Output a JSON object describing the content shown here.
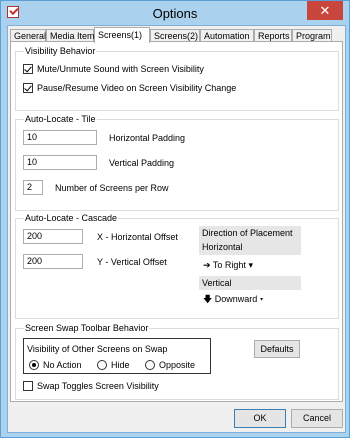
{
  "window": {
    "title": "Options",
    "close_glyph": "✕"
  },
  "tabs": [
    {
      "label": "General"
    },
    {
      "label": "Media Item"
    },
    {
      "label": "Screens(1)"
    },
    {
      "label": "Screens(2)"
    },
    {
      "label": "Automation"
    },
    {
      "label": "Reports"
    },
    {
      "label": "Program"
    }
  ],
  "visibility": {
    "title": "Visibility Behavior",
    "mute_label": "Mute/Unmute Sound with Screen Visibility",
    "mute_checked": true,
    "pause_label": "Pause/Resume Video on Screen Visibility Change",
    "pause_checked": true
  },
  "tile": {
    "title": "Auto-Locate  - Tile",
    "h_padding_value": "10",
    "h_padding_label": "Horizontal Padding",
    "v_padding_value": "10",
    "v_padding_label": "Vertical Padding",
    "screens_per_row_value": "2",
    "screens_per_row_label": "Number of Screens per Row"
  },
  "cascade": {
    "title": "Auto-Locate  - Cascade",
    "x_offset_value": "200",
    "x_offset_label": "X - Horizontal Offset",
    "y_offset_value": "200",
    "y_offset_label": "Y - Vertical Offset",
    "direction_title": "Direction of Placement",
    "horizontal_label": "Horizontal",
    "horizontal_value": "To Right",
    "horizontal_arrow": "➔",
    "vertical_label": "Vertical",
    "vertical_value": "Downward",
    "vertical_arrow": "🡇",
    "caret": "▾"
  },
  "swap": {
    "title": "Screen Swap Toolbar Behavior",
    "defaults_label": "Defaults",
    "visibility_group_title": "Visibility of Other Screens on Swap",
    "options": [
      {
        "label": "No Action",
        "selected": true
      },
      {
        "label": "Hide",
        "selected": false
      },
      {
        "label": "Opposite",
        "selected": false
      }
    ],
    "toggle_label": "Swap Toggles Screen Visibility",
    "toggle_checked": false
  },
  "footer": {
    "ok_label": "OK",
    "cancel_label": "Cancel"
  }
}
